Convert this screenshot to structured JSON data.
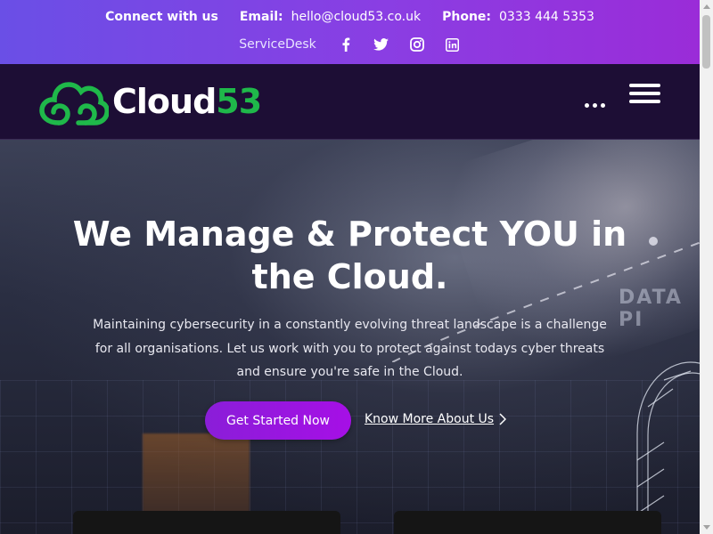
{
  "topbar": {
    "connect": "Connect with us",
    "email_label": "Email:",
    "email_value": "hello@cloud53.co.uk",
    "phone_label": "Phone:",
    "phone_value": "0333 444 5353",
    "servicedesk": "ServiceDesk",
    "social": [
      "facebook-icon",
      "twitter-icon",
      "instagram-icon",
      "linkedin-icon"
    ]
  },
  "header": {
    "logo_white": "Cloud",
    "logo_green": "53"
  },
  "hero": {
    "title": "We Manage & Protect YOU in the Cloud.",
    "subtitle": "Maintaining cybersecurity in a constantly evolving threat landscape is a challenge for all organisations. Let us work with you to protect against todays cyber threats and ensure you're safe in the Cloud.",
    "primary_button": "Get Started Now",
    "secondary_link": "Know More About Us",
    "background_text": "DATA PI"
  },
  "colors": {
    "topbar_start": "#6a4fe6",
    "topbar_end": "#9a2cd8",
    "header_bg": "#1d0e35",
    "brand_green": "#1fb84a",
    "button_purple": "#9a16e0"
  }
}
